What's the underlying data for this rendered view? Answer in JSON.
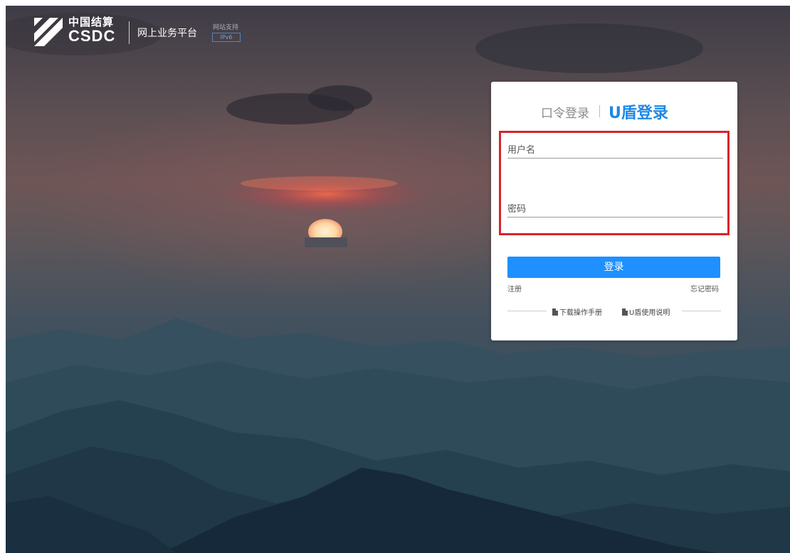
{
  "header": {
    "logo_cn": "中国结算",
    "logo_en": "CSDC",
    "platform_name": "网上业务平台",
    "support_text": "网站支持",
    "ipv6_badge": "IPv6"
  },
  "login": {
    "tab_password": "口令登录",
    "tab_ukey": "U盾登录",
    "active_tab": "U盾登录",
    "username_placeholder": "用户名",
    "password_placeholder": "密码",
    "login_button": "登录",
    "register_link": "注册",
    "forgot_link": "忘记密码",
    "download_manual": "下载操作手册",
    "ukey_guide": "U盾使用说明"
  },
  "colors": {
    "accent": "#1e90ff",
    "active_tab": "#1e88e5",
    "highlight_border": "#d8232a"
  }
}
